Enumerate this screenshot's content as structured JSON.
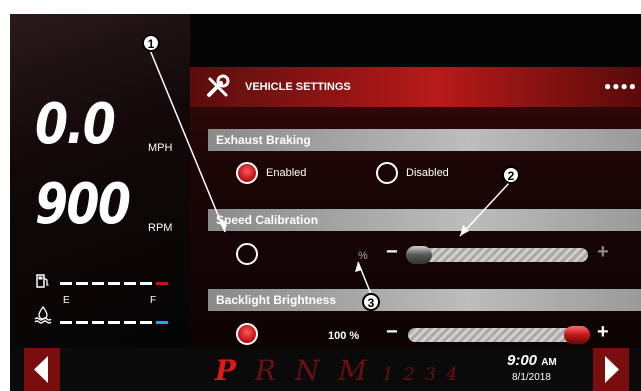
{
  "cluster": {
    "speed_value": "0.0",
    "speed_unit": "MPH",
    "rpm_value": "900",
    "rpm_unit": "RPM",
    "fuel_icon": "fuel-pump-icon",
    "fluid_icon": "def-fluid-icon",
    "fluid_empty_label": "E",
    "fluid_full_label": "F"
  },
  "settings": {
    "title": "VEHICLE SETTINGS",
    "title_icon": "wrench-screwdriver-icon",
    "page_dots": "●●●●",
    "sections": [
      {
        "title": "Exhaust Braking",
        "options": [
          {
            "label": "Enabled",
            "selected": true
          },
          {
            "label": "Disabled",
            "selected": false
          }
        ]
      },
      {
        "title": "Speed Calibration",
        "value_label": "%",
        "slider_level": 0.05
      },
      {
        "title": "Backlight Brightness",
        "value_label": "100 %",
        "slider_level": 1.0
      }
    ]
  },
  "bottom": {
    "gears": [
      "P",
      "R",
      "N",
      "M"
    ],
    "gear_numbers": [
      "1",
      "2",
      "3",
      "4"
    ],
    "active_gear": "P",
    "time": "9:00",
    "ampm": "AM",
    "date": "8/1/2018"
  },
  "callouts": [
    "1",
    "2",
    "3"
  ],
  "colors": {
    "accent_red": "#c0161a",
    "header_red": "#b81a1a",
    "fluid_blue": "#2aa7e0"
  }
}
